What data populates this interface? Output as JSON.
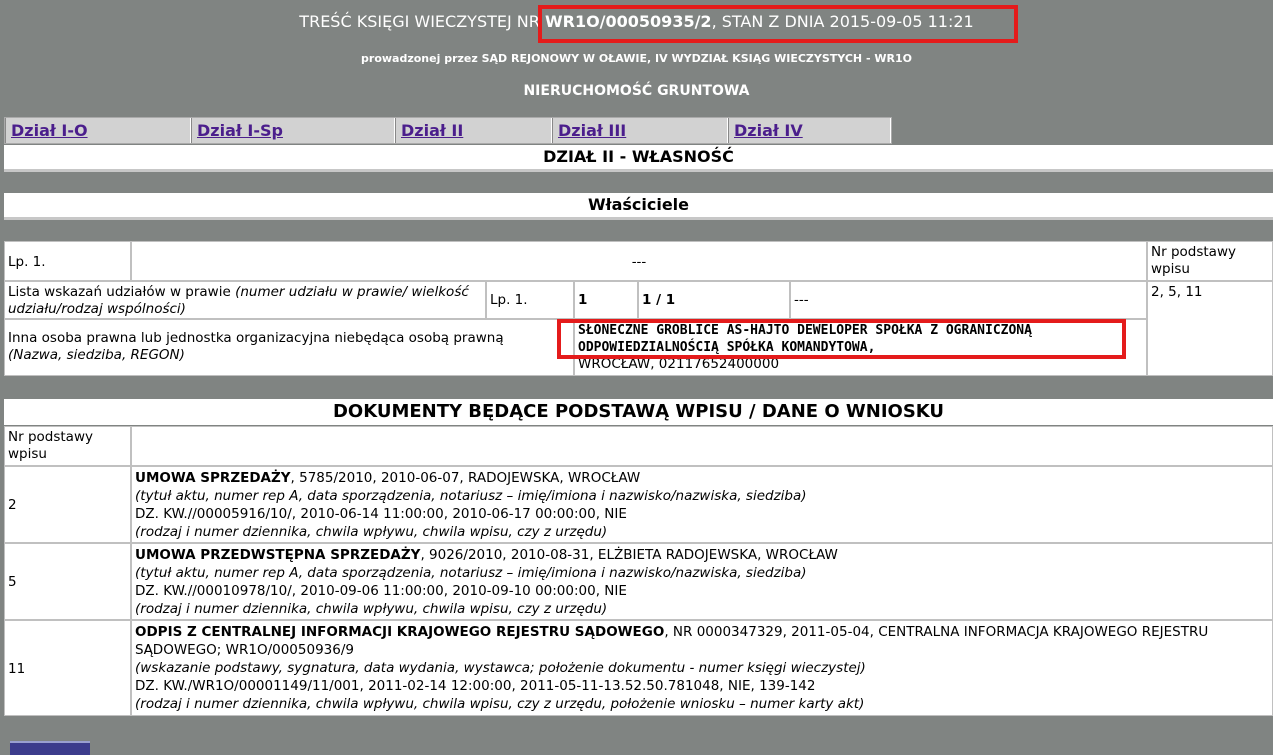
{
  "header": {
    "prefix": "TREŚĆ KSIĘGI WIECZYSTEJ NR ",
    "number": "WR1O/00050935/2",
    "suffix": ", STAN Z DNIA 2015-09-05 11:21",
    "court": "prowadzonej przez SĄD REJONOWY W OŁAWIE, IV WYDZIAŁ KSIĄG WIECZYSTYCH - WR1O",
    "type": "NIERUCHOMOŚĆ GRUNTOWA"
  },
  "tabs": [
    "Dział I-O",
    "Dział I-Sp",
    "Dział II",
    "Dział III",
    "Dział IV"
  ],
  "section_title": "DZIAŁ II - WŁASNOŚĆ",
  "subsection_title": "Właściciele",
  "owners": {
    "lp_label": "Lp. 1.",
    "dashes": "---",
    "nr_podstawy_header": "Nr podstawy wpisu",
    "nr_podstawy_value": "2, 5, 11",
    "share_label": "Lista wskazań udziałów w prawie",
    "share_label_italic": "(numer udziału w prawie/ wielkość udziału/rodzaj wspólności)",
    "share_lp": "Lp. 1.",
    "share_num": "1",
    "share_size": "1 / 1",
    "share_type": "---",
    "entity_label": "Inna osoba prawna lub jednostka organizacyjna niebędąca osobą prawną",
    "entity_label_italic": "(Nazwa, siedziba, REGON)",
    "entity_name": "SŁONECZNE GROBLICE AS-HAJTO DEWELOPER SPÓŁKA Z OGRANICZONĄ ODPOWIEDZIALNOŚCIĄ SPÓŁKA KOMANDYTOWA,",
    "entity_details": "WROCŁAW, 02117652400000"
  },
  "documents": {
    "title": "DOKUMENTY BĘDĄCE PODSTAWĄ WPISU / DANE O WNIOSKU",
    "nr_header": "Nr podstawy wpisu",
    "rows": [
      {
        "nr": "2",
        "title_bold": "UMOWA SPRZEDAŻY",
        "title_rest": ", 5785/2010, 2010-06-07, RADOJEWSKA, WROCŁAW",
        "hint1": "(tytuł aktu, numer rep A, data sporządzenia, notariusz – imię/imiona i nazwisko/nazwiska, siedziba)",
        "kw": "DZ. KW.//00005916/10/, 2010-06-14 11:00:00, 2010-06-17 00:00:00, NIE",
        "hint2": "(rodzaj i numer dziennika, chwila wpływu, chwila wpisu, czy z urzędu)"
      },
      {
        "nr": "5",
        "title_bold": "UMOWA PRZEDWSTĘPNA SPRZEDAŻY",
        "title_rest": ", 9026/2010, 2010-08-31, ELŻBIETA RADOJEWSKA, WROCŁAW",
        "hint1": "(tytuł aktu, numer rep A, data sporządzenia, notariusz – imię/imiona i nazwisko/nazwiska, siedziba)",
        "kw": "DZ. KW.//00010978/10/, 2010-09-06 11:00:00, 2010-09-10 00:00:00, NIE",
        "hint2": "(rodzaj i numer dziennika, chwila wpływu, chwila wpisu, czy z urzędu)"
      },
      {
        "nr": "11",
        "title_bold": "ODPIS Z CENTRALNEJ INFORMACJI KRAJOWEGO REJESTRU SĄDOWEGO",
        "title_rest": ", NR 0000347329, 2011-05-04, CENTRALNA INFORMACJA KRAJOWEGO REJESTRU SĄDOWEGO; WR1O/00050936/9",
        "hint1": "(wskazanie podstawy, sygnatura, data wydania, wystawca; położenie dokumentu - numer księgi wieczystej)",
        "kw": "DZ. KW./WR1O/00001149/11/001, 2011-02-14 12:00:00, 2011-05-11-13.52.50.781048, NIE, 139-142",
        "hint2": "(rodzaj i numer dziennika, chwila wpływu, chwila wpisu, czy z urzędu, położenie wniosku – numer karty akt)"
      }
    ]
  }
}
